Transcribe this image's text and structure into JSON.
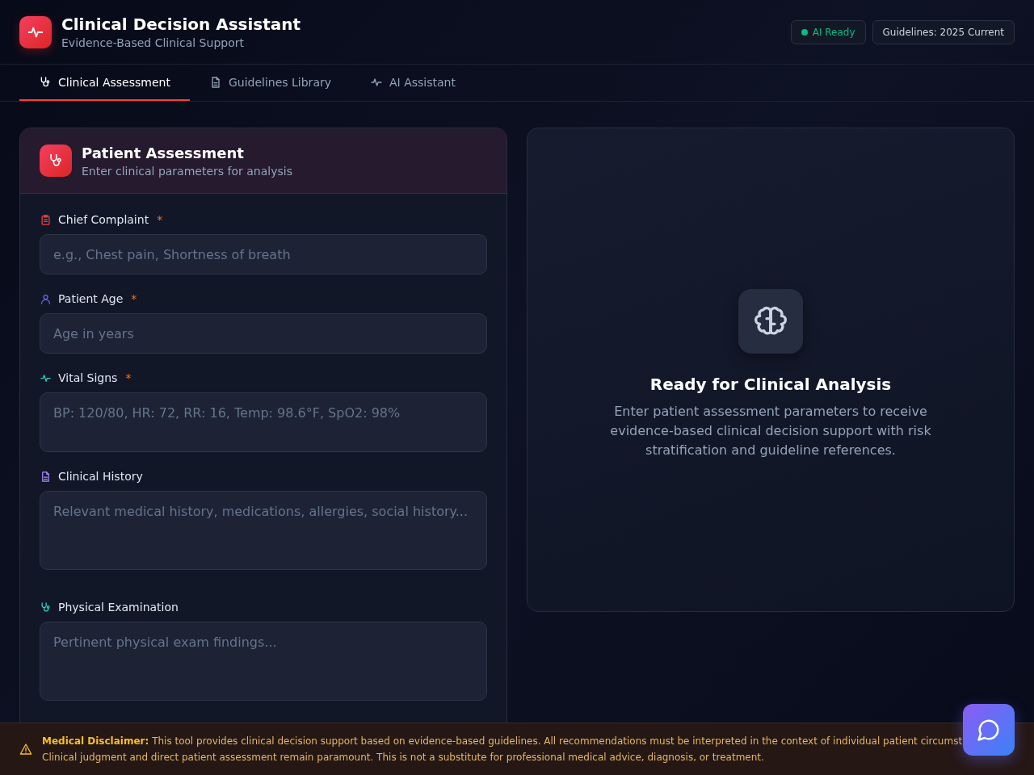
{
  "header": {
    "title": "Clinical Decision Assistant",
    "subtitle": "Evidence-Based Clinical Support",
    "badges": [
      {
        "label": "AI Ready",
        "color": "#10b981"
      },
      {
        "label": "Guidelines: 2025 Current"
      }
    ]
  },
  "tabs": [
    {
      "label": "Clinical Assessment",
      "selected": true
    },
    {
      "label": "Guidelines Library",
      "selected": false
    },
    {
      "label": "AI Assistant",
      "selected": false
    }
  ],
  "assessment": {
    "title": "Patient Assessment",
    "subtitle": "Enter clinical parameters for analysis",
    "fields": [
      {
        "kind": "input",
        "label": "Chief Complaint",
        "required_mark": "*",
        "placeholder": "e.g., Chest pain, Shortness of breath"
      },
      {
        "kind": "input",
        "label": "Patient Age",
        "required_mark": "*",
        "placeholder": "Age in years"
      },
      {
        "kind": "textarea",
        "label": "Vital Signs",
        "required_mark": "*",
        "placeholder": "BP: 120/80, HR: 72, RR: 16, Temp: 98.6°F, SpO2: 98%"
      },
      {
        "kind": "textarea",
        "label": "Clinical History",
        "placeholder": "Relevant medical history, medications, allergies, social history..."
      },
      {
        "kind": "textarea",
        "label": "Physical Examination",
        "placeholder": "Pertinent physical exam findings..."
      }
    ]
  },
  "analysis": {
    "title": "Ready for Clinical Analysis",
    "text": "Enter patient assessment parameters to receive evidence-based clinical decision support with risk stratification and guideline references."
  },
  "disclaimer": {
    "label": "Medical Disclaimer:",
    "lines": [
      "This tool provides clinical decision support based on evidence-based guidelines. All recommendations must be interpreted in the context of individual patient circumst",
      "Clinical judgment and direct patient assessment remain paramount. This is not a substitute for professional medical advice, diagnosis, or treatment."
    ]
  }
}
